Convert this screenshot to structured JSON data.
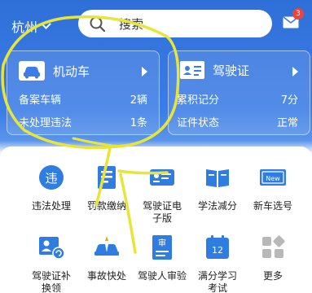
{
  "header": {
    "city": "杭州",
    "search_placeholder": "搜索",
    "mail_badge": "3"
  },
  "vehicle_card": {
    "title": "机动车",
    "row1_label": "备案车辆",
    "row1_value": "2辆",
    "row2_label": "未处理违法",
    "row2_value": "1条"
  },
  "license_card": {
    "title": "驾驶证",
    "row1_label": "累积记分",
    "row1_value": "7分",
    "row2_label": "证件状态",
    "row2_value": "正常"
  },
  "services": [
    {
      "label": "违法处理",
      "icon": "violation-icon"
    },
    {
      "label": "罚款缴纳",
      "icon": "fine-payment-icon"
    },
    {
      "label": "驾驶证电子版",
      "line1": "驾驶证电",
      "line2": "子版",
      "icon": "e-license-icon"
    },
    {
      "label": "学法减分",
      "icon": "study-book-icon"
    },
    {
      "label": "新车选号",
      "icon": "new-plate-icon"
    },
    {
      "label": "驾驶证补换领",
      "line1": "驾驶证补",
      "line2": "换领",
      "icon": "license-renew-icon"
    },
    {
      "label": "事故快处",
      "icon": "accident-icon"
    },
    {
      "label": "驾驶人审验",
      "icon": "driver-review-icon"
    },
    {
      "label": "满分学习考试",
      "line1": "满分学习",
      "line2": "考试",
      "icon": "exam-calendar-icon"
    },
    {
      "label": "更多",
      "icon": "more-grid-icon"
    }
  ],
  "colors": {
    "header_blue": "#3b7de6",
    "icon_blue": "#2f7de1",
    "badge_red": "#e8453c",
    "highlighter_yellow": "#e8e53a"
  }
}
